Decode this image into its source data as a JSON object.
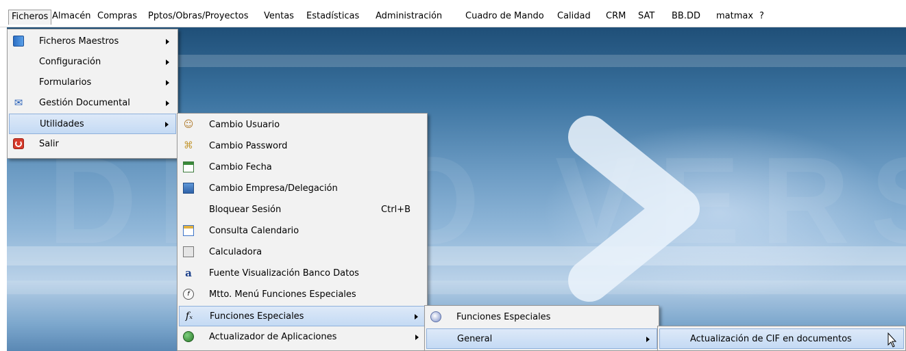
{
  "menubar": {
    "items": [
      "Ficheros",
      "Almacén",
      "Compras",
      "Pptos/Obras/Proyectos",
      "Ventas",
      "Estadísticas",
      "Administración",
      "Cuadro de Mando",
      "Calidad",
      "CRM",
      "SAT",
      "BB.DD",
      "matmax",
      "?"
    ]
  },
  "menu_ficheros": {
    "items": [
      {
        "label": "Ficheros Maestros",
        "icon": "book-icon",
        "submenu": true
      },
      {
        "label": "Configuración",
        "submenu": true
      },
      {
        "label": "Formularios",
        "submenu": true
      },
      {
        "label": "Gestión Documental",
        "icon": "document-management-icon",
        "submenu": true
      },
      {
        "label": "Utilidades",
        "submenu": true,
        "highlighted": true
      },
      {
        "label": "Salir",
        "icon": "exit-icon"
      }
    ]
  },
  "menu_utilidades": {
    "items": [
      {
        "label": "Cambio Usuario",
        "icon": "users-icon"
      },
      {
        "label": "Cambio Password",
        "icon": "key-icon"
      },
      {
        "label": "Cambio Fecha",
        "icon": "calendar-icon"
      },
      {
        "label": "Cambio Empresa/Delegación",
        "icon": "bank-icon"
      },
      {
        "label": "Bloquear Sesión",
        "shortcut": "Ctrl+B"
      },
      {
        "label": "Consulta Calendario",
        "icon": "calendar-view-icon"
      },
      {
        "label": "Calculadora",
        "icon": "calculator-icon"
      },
      {
        "label": "Fuente Visualización Banco Datos",
        "icon": "font-icon"
      },
      {
        "label": "Mtto. Menú Funciones Especiales",
        "icon": "function-settings-icon"
      },
      {
        "label": "Funciones Especiales",
        "icon": "fx-icon",
        "submenu": true,
        "highlighted": true
      },
      {
        "label": "Actualizador de Aplicaciones",
        "icon": "globe-icon",
        "submenu": true
      }
    ]
  },
  "menu_funciones": {
    "items": [
      {
        "label": "Funciones Especiales",
        "icon": "disk-icon"
      },
      {
        "label": "General",
        "submenu": true,
        "highlighted": true
      }
    ]
  },
  "menu_general": {
    "items": [
      {
        "label": "Actualización de CIF en documentos",
        "highlighted": true
      }
    ]
  },
  "colors": {
    "menu_bg": "#f2f2f2",
    "highlight": "#c4daf4",
    "desktop_top": "#1f4f78",
    "desktop_mid": "#8fb6d8"
  }
}
